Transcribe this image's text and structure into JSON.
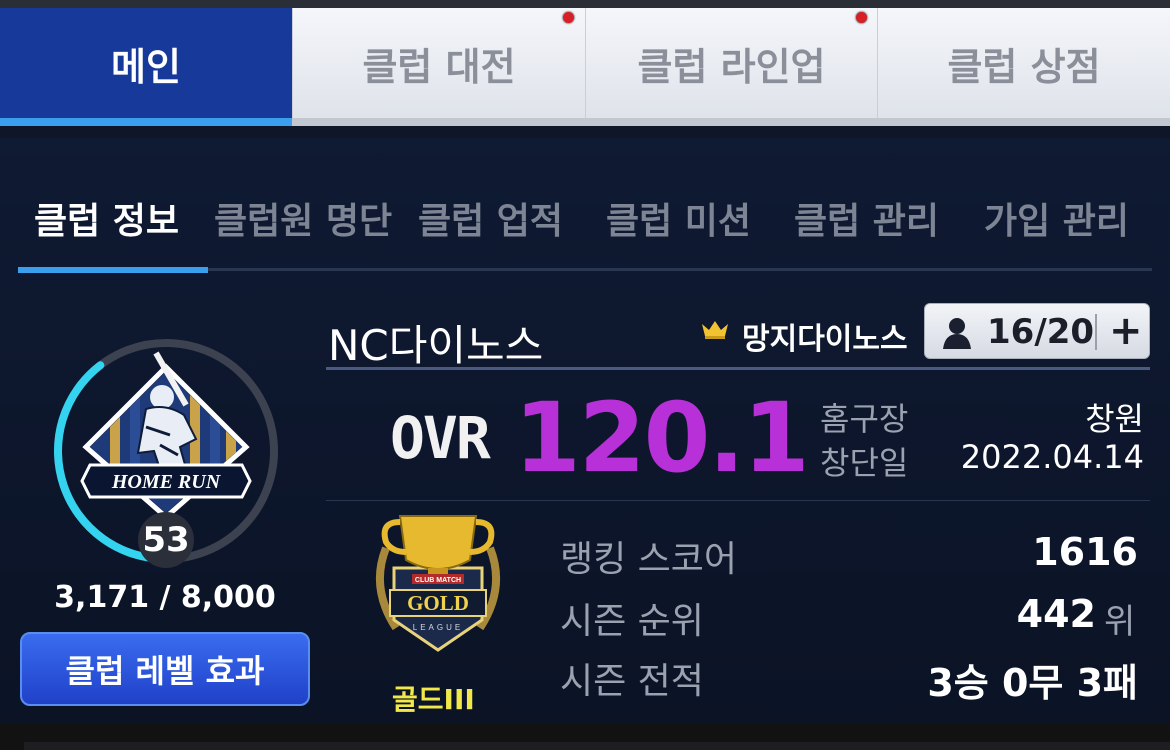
{
  "top_tabs": [
    {
      "label": "메인",
      "active": true
    },
    {
      "label": "클럽 대전",
      "active": false
    },
    {
      "label": "클럽 라인업",
      "active": false
    },
    {
      "label": "클럽 상점",
      "active": false
    }
  ],
  "sub_tabs": [
    {
      "label": "클럽 정보",
      "active": true
    },
    {
      "label": "클럽원 명단",
      "active": false
    },
    {
      "label": "클럽 업적",
      "active": false
    },
    {
      "label": "클럽 미션",
      "active": false
    },
    {
      "label": "클럽 관리",
      "active": false
    },
    {
      "label": "가입 관리",
      "active": false
    }
  ],
  "emblem": {
    "banner_text": "HOME RUN",
    "level": "53",
    "exp": "3,171 / 8,000",
    "exp_progress": 0.396
  },
  "level_button_label": "클럽 레벨 효과",
  "club": {
    "name": "NC다이노스",
    "leader": "망지다이노스",
    "members": "16/20",
    "add_symbol": "+",
    "ovr_label": "OVR",
    "ovr_value": "120.1",
    "home_label": "홈구장",
    "home_value": "창원",
    "founded_label": "창단일",
    "founded_value": "2022.04.14"
  },
  "league": {
    "badge_top_text": "CLUB MATCH",
    "badge_text": "GOLD",
    "badge_sub_text": "LEAGUE",
    "name": "골드III",
    "ranking_label": "랭킹 스코어",
    "ranking_value": "1616",
    "rank_label": "시즌 순위",
    "rank_value": "442",
    "rank_unit": "위",
    "record_label": "시즌 전적",
    "record_value": "3승 0무 3패"
  },
  "colors": {
    "active_tab": "#173a9a",
    "accent_blue": "#3aa0ee",
    "ovr_purple": "#b830d8",
    "league_yellow": "#f2e84a",
    "notification_red": "#d81f26"
  }
}
